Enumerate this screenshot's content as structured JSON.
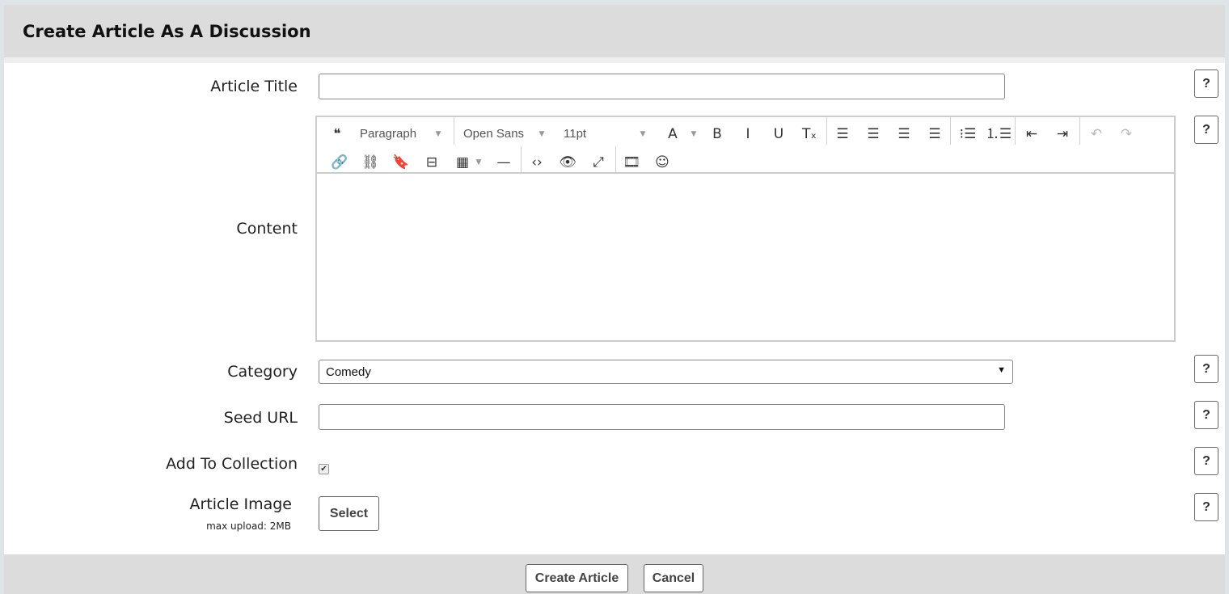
{
  "header": {
    "title": "Create Article As A Discussion"
  },
  "form": {
    "article_title": {
      "label": "Article Title",
      "value": "",
      "help": "?"
    },
    "content": {
      "label": "Content",
      "value": "",
      "help": "?"
    },
    "category": {
      "label": "Category",
      "value": "Comedy",
      "help": "?"
    },
    "seed_url": {
      "label": "Seed URL",
      "value": "",
      "help": "?"
    },
    "add_to_collection": {
      "label": "Add To Collection",
      "checked": true,
      "help": "?"
    },
    "article_image": {
      "label": "Article Image",
      "sublabel": "max upload: 2MB",
      "select_label": "Select",
      "help": "?"
    }
  },
  "editor": {
    "block_format": "Paragraph",
    "font_family": "Open Sans",
    "font_size": "11pt",
    "toolbar_row1": [
      "blockquote-icon",
      "block-format-dropdown",
      "font-family-dropdown",
      "font-size-dropdown",
      "text-color-icon",
      "bold-icon",
      "italic-icon",
      "underline-icon",
      "clear-formatting-icon",
      "align-left-icon",
      "align-center-icon",
      "align-right-icon",
      "align-justify-icon",
      "bullet-list-icon",
      "numbered-list-icon",
      "outdent-icon",
      "indent-icon",
      "undo-icon",
      "redo-icon"
    ],
    "toolbar_row2": [
      "link-icon",
      "unlink-icon",
      "bookmark-icon",
      "page-break-icon",
      "table-icon",
      "horizontal-rule-icon",
      "source-code-icon",
      "preview-icon",
      "fullscreen-icon",
      "media-icon",
      "emoticons-icon"
    ]
  },
  "footer": {
    "create_label": "Create Article",
    "cancel_label": "Cancel"
  }
}
